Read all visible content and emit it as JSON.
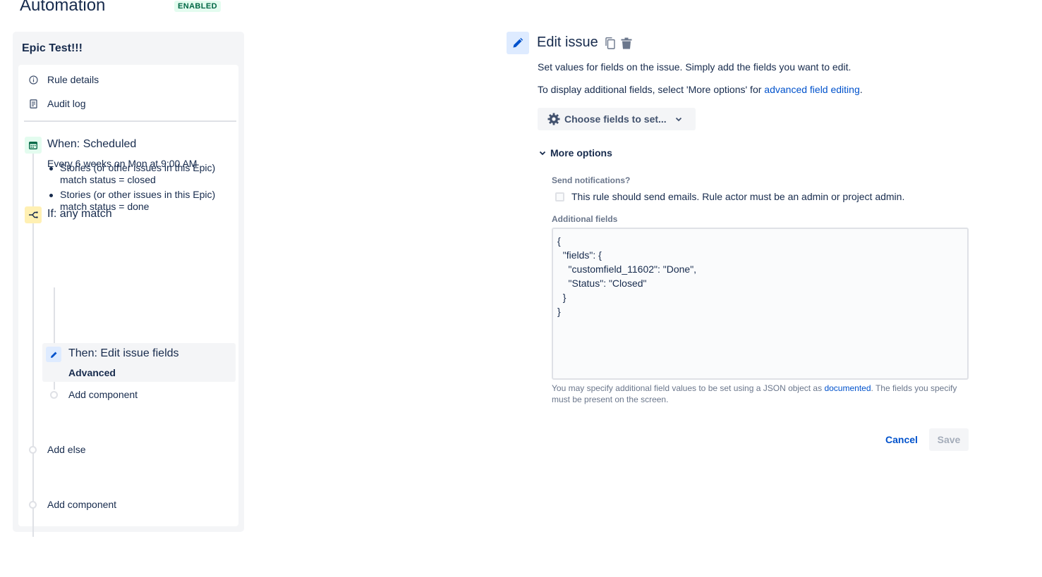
{
  "header": {
    "title": "Automation",
    "status_badge": "ENABLED"
  },
  "rule": {
    "name": "Epic Test!!!",
    "nav": [
      {
        "label": "Rule details",
        "icon": "info-icon"
      },
      {
        "label": "Audit log",
        "icon": "document-icon"
      }
    ],
    "trigger": {
      "title": "When: Scheduled",
      "subtitle": "Every 6 weeks on Mon at 9:00 AM",
      "icon": "calendar-icon",
      "color": "#e3fcef"
    },
    "condition": {
      "title": "If: any match",
      "icon": "branch-icon",
      "color": "#fff0b3",
      "items": [
        {
          "line1": "Stories (or other issues in this Epic)",
          "line2": "match status = closed"
        },
        {
          "line1": "Stories (or other issues in this Epic)",
          "line2": "match status = done"
        }
      ]
    },
    "action": {
      "title": "Then: Edit issue fields",
      "subtitle": "Advanced",
      "icon": "pencil-icon",
      "color": "#deebff"
    },
    "add_component_inner": "Add component",
    "add_else": "Add else",
    "add_component_outer": "Add component"
  },
  "editor": {
    "title": "Edit issue",
    "description": "Set values for fields on the issue. Simply add the fields you want to edit.",
    "additional_prefix": "To display additional fields, select 'More options' for ",
    "additional_link": "advanced field editing",
    "additional_suffix": ".",
    "choose_fields_label": "Choose fields to set...",
    "more_options_label": "More options",
    "send_notifications_label": "Send notifications?",
    "send_notifications_checkbox": "This rule should send emails. Rule actor must be an admin or project admin.",
    "send_notifications_checked": false,
    "additional_fields_label": "Additional fields",
    "additional_fields_value": "{\n  \"fields\": {\n    \"customfield_11602\": \"Done\",\n    \"Status\": \"Closed\"\n  }\n}",
    "help_prefix": "You may specify additional field values to be set using a JSON object as ",
    "help_link": "documented",
    "help_suffix": ". The fields you specify must be present on the screen.",
    "cancel_label": "Cancel",
    "save_label": "Save"
  },
  "colors": {
    "accent": "#0052cc",
    "text": "#172b4d",
    "subtle": "#6b778c",
    "badge_bg": "#e3fcef",
    "badge_text": "#006644"
  }
}
